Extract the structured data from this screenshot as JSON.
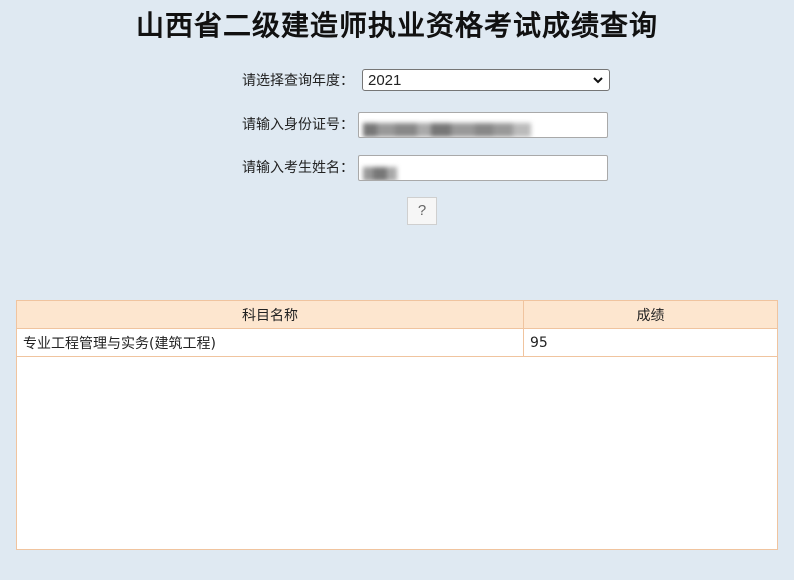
{
  "page": {
    "title": "山西省二级建造师执业资格考试成绩查询"
  },
  "form": {
    "year_label": "请选择查询年度：",
    "year_value": "2021",
    "id_label": "请输入身份证号：",
    "id_value": "",
    "name_label": "请输入考生姓名：",
    "name_value": "",
    "submit_label": "?"
  },
  "results": {
    "columns": [
      "科目名称",
      "成绩"
    ],
    "rows": [
      {
        "subject": "专业工程管理与实务(建筑工程)",
        "score": "95"
      }
    ]
  },
  "colors": {
    "background": "#dfe9f2",
    "table_header": "#fde6cf",
    "table_border": "#f0c49f"
  },
  "icons": {
    "select_arrow": "chevron-down-icon"
  }
}
